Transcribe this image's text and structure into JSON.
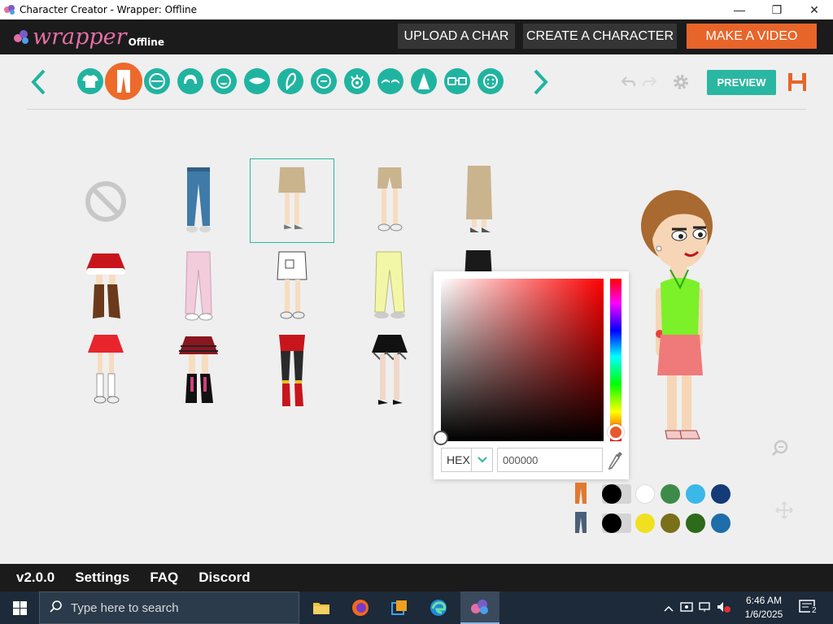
{
  "window": {
    "title": "Character Creator - Wrapper: Offline",
    "controls": {
      "minimize": "—",
      "maximize": "❐",
      "close": "✕"
    }
  },
  "header": {
    "logo_text": "wrapper",
    "logo_sub": "Offline",
    "buttons": {
      "upload": "UPLOAD A CHAR",
      "create": "CREATE A CHARACTER",
      "make_video": "MAKE A VIDEO"
    }
  },
  "toolbar": {
    "categories": [
      "upper-body",
      "lower-body",
      "face-shape",
      "hair",
      "facial-hair",
      "mouth",
      "ear",
      "nose-shape",
      "eyes",
      "eyebrows",
      "nose",
      "glasses",
      "face-extras"
    ],
    "active_category": "lower-body",
    "preview_label": "PREVIEW"
  },
  "picker": {
    "format": "HEX",
    "hex_value": "000000",
    "selected_hue": "#e8582a"
  },
  "swatches": {
    "row1": {
      "part": "skirt",
      "colors": [
        "#000000",
        "#ffffff",
        "#3d8a4a",
        "#3ab8e8",
        "#143a78"
      ]
    },
    "row2": {
      "part": "legs",
      "colors": [
        "#000000",
        "#f0e020",
        "#7a701a",
        "#2d6a1a",
        "#1e6eaa"
      ]
    }
  },
  "footer": {
    "version": "v2.0.0",
    "links": [
      "Settings",
      "FAQ",
      "Discord"
    ]
  },
  "taskbar": {
    "search_placeholder": "Type here to search",
    "time": "6:46 AM",
    "date": "1/6/2025",
    "notifications": "2"
  }
}
